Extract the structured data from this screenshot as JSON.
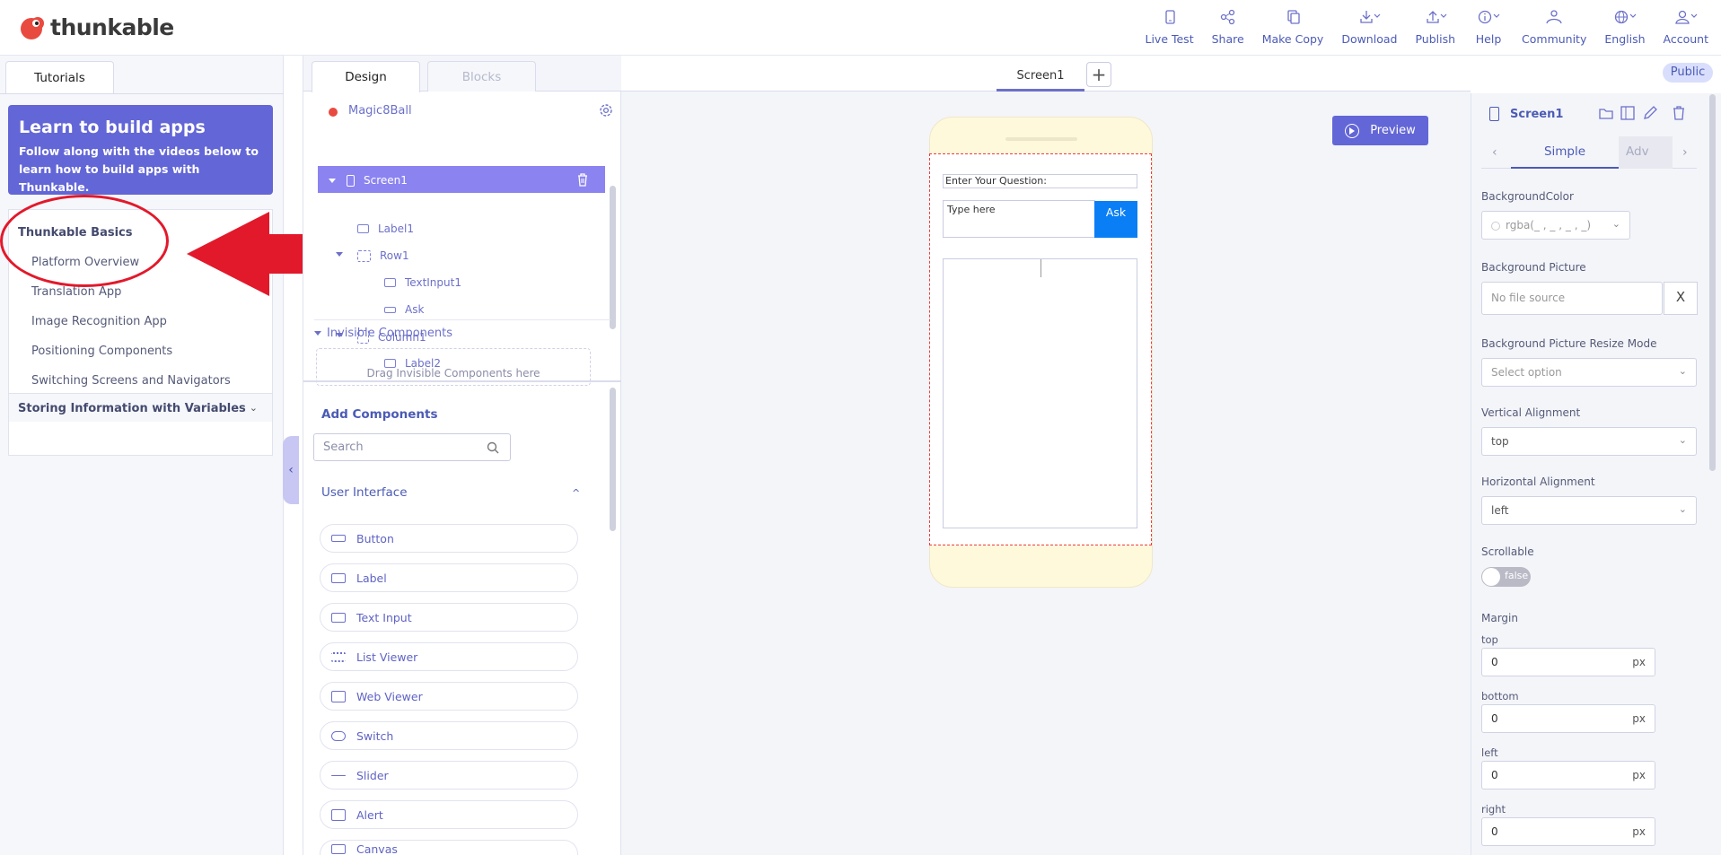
{
  "brand": {
    "name": "thunkable"
  },
  "topnav": [
    {
      "id": "live-test",
      "label": "Live Test",
      "icon": "phone-icon"
    },
    {
      "id": "share",
      "label": "Share",
      "icon": "share-icon"
    },
    {
      "id": "make-copy",
      "label": "Make Copy",
      "icon": "copy-icon"
    },
    {
      "id": "download",
      "label": "Download",
      "icon": "download-icon"
    },
    {
      "id": "publish",
      "label": "Publish",
      "icon": "upload-icon"
    },
    {
      "id": "help",
      "label": "Help",
      "icon": "info-icon"
    },
    {
      "id": "community",
      "label": "Community",
      "icon": "people-icon"
    },
    {
      "id": "english",
      "label": "English",
      "icon": "globe-icon"
    },
    {
      "id": "account",
      "label": "Account",
      "icon": "user-icon"
    }
  ],
  "tutorials": {
    "tab": "Tutorials",
    "card_title": "Learn to build apps",
    "card_text": "Follow along with the videos below to learn how to build apps with Thunkable.",
    "section": "Thunkable Basics",
    "items": [
      "Platform Overview",
      "Translation App",
      "Image Recognition App",
      "Positioning Components",
      "Switching Screens and Navigators"
    ],
    "section2": "Storing Information with Variables"
  },
  "designer": {
    "tabs": {
      "design": "Design",
      "blocks": "Blocks"
    },
    "app_name": "Magic8Ball",
    "tree": [
      {
        "label": "Screen1"
      },
      {
        "label": "Label1"
      },
      {
        "label": "Row1"
      },
      {
        "label": "TextInput1"
      },
      {
        "label": "Ask"
      },
      {
        "label": "Column1"
      },
      {
        "label": "Label2"
      }
    ],
    "invisible_head": "Invisible Components",
    "invisible_hint": "Drag Invisible Components here",
    "add_head": "Add Components",
    "search_placeholder": "Search",
    "ui_head": "User Interface",
    "components": [
      "Button",
      "Label",
      "Text Input",
      "List Viewer",
      "Web Viewer",
      "Switch",
      "Slider",
      "Alert",
      "Canvas"
    ]
  },
  "canvas": {
    "screen_tab": "Screen1",
    "add_label": "+",
    "public": "Public",
    "preview": "Preview",
    "question_label": "Enter Your Question:",
    "input_placeholder": "Type here",
    "ask": "Ask"
  },
  "props": {
    "title": "Screen1",
    "tab_simple": "Simple",
    "tab_adv": "Adv",
    "bgcolor_label": "BackgroundColor",
    "bgcolor_value": "rgba(_ , _ , _ , _)",
    "bgpic_label": "Background Picture",
    "bgpic_value": "No file source",
    "bgpic_clear": "X",
    "resize_label": "Background Picture Resize Mode",
    "resize_value": "Select option",
    "valign_label": "Vertical Alignment",
    "valign_value": "top",
    "halign_label": "Horizontal Alignment",
    "halign_value": "left",
    "scroll_label": "Scrollable",
    "scroll_value": "false",
    "margin_label": "Margin",
    "margins": [
      {
        "side": "top",
        "value": "0",
        "unit": "px"
      },
      {
        "side": "bottom",
        "value": "0",
        "unit": "px"
      },
      {
        "side": "left",
        "value": "0",
        "unit": "px"
      },
      {
        "side": "right",
        "value": "0",
        "unit": "px"
      }
    ]
  },
  "colors": {
    "accent": "#6366d6",
    "annotation": "#e2192b",
    "ask_button": "#0a7ff5"
  }
}
